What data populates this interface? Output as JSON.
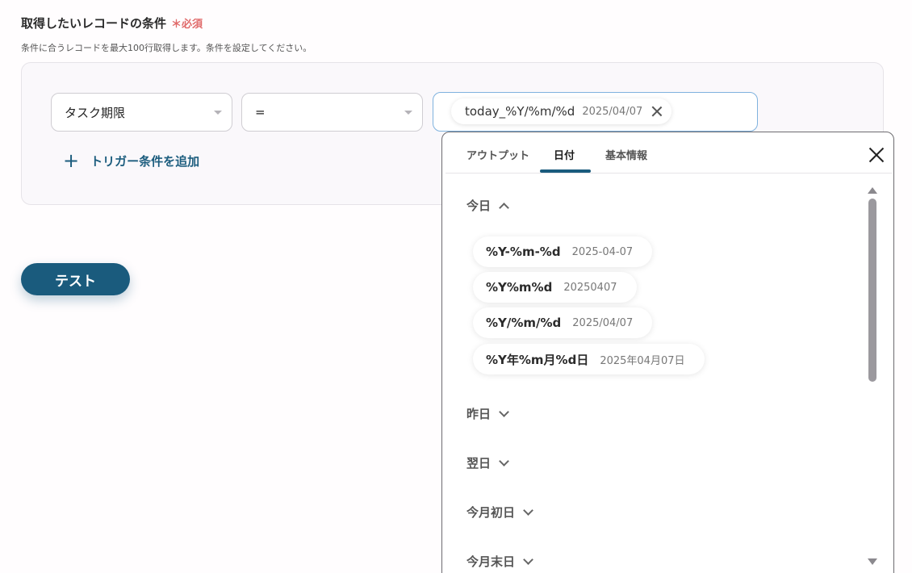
{
  "section": {
    "title": "取得したいレコードの条件",
    "required_label": "＊必須",
    "description": "条件に合うレコードを最大100行取得します。条件を設定してください。"
  },
  "condition": {
    "field_select": "タスク期限",
    "operator_select": "=",
    "value_chip": {
      "key": "today_%Y/%m/%d",
      "preview": "2025/04/07"
    },
    "add_trigger_label": "トリガー条件を追加",
    "add_icon": "plus-icon"
  },
  "test_button": "テスト",
  "popup": {
    "tabs": [
      {
        "label": "アウトプット",
        "active": false
      },
      {
        "label": "日付",
        "active": true
      },
      {
        "label": "基本情報",
        "active": false
      }
    ],
    "groups": [
      {
        "label": "今日",
        "expanded": true,
        "options": [
          {
            "key": "%Y-%m-%d",
            "preview": "2025-04-07"
          },
          {
            "key": "%Y%m%d",
            "preview": "20250407"
          },
          {
            "key": "%Y/%m/%d",
            "preview": "2025/04/07"
          },
          {
            "key": "%Y年%m月%d日",
            "preview": "2025年04月07日"
          }
        ]
      },
      {
        "label": "昨日",
        "expanded": false
      },
      {
        "label": "翌日",
        "expanded": false
      },
      {
        "label": "今月初日",
        "expanded": false
      },
      {
        "label": "今月末日",
        "expanded": false
      }
    ]
  },
  "colors": {
    "accent": "#1a5b7d",
    "required": "#e06a6a",
    "focus_border": "#7fb2de"
  }
}
